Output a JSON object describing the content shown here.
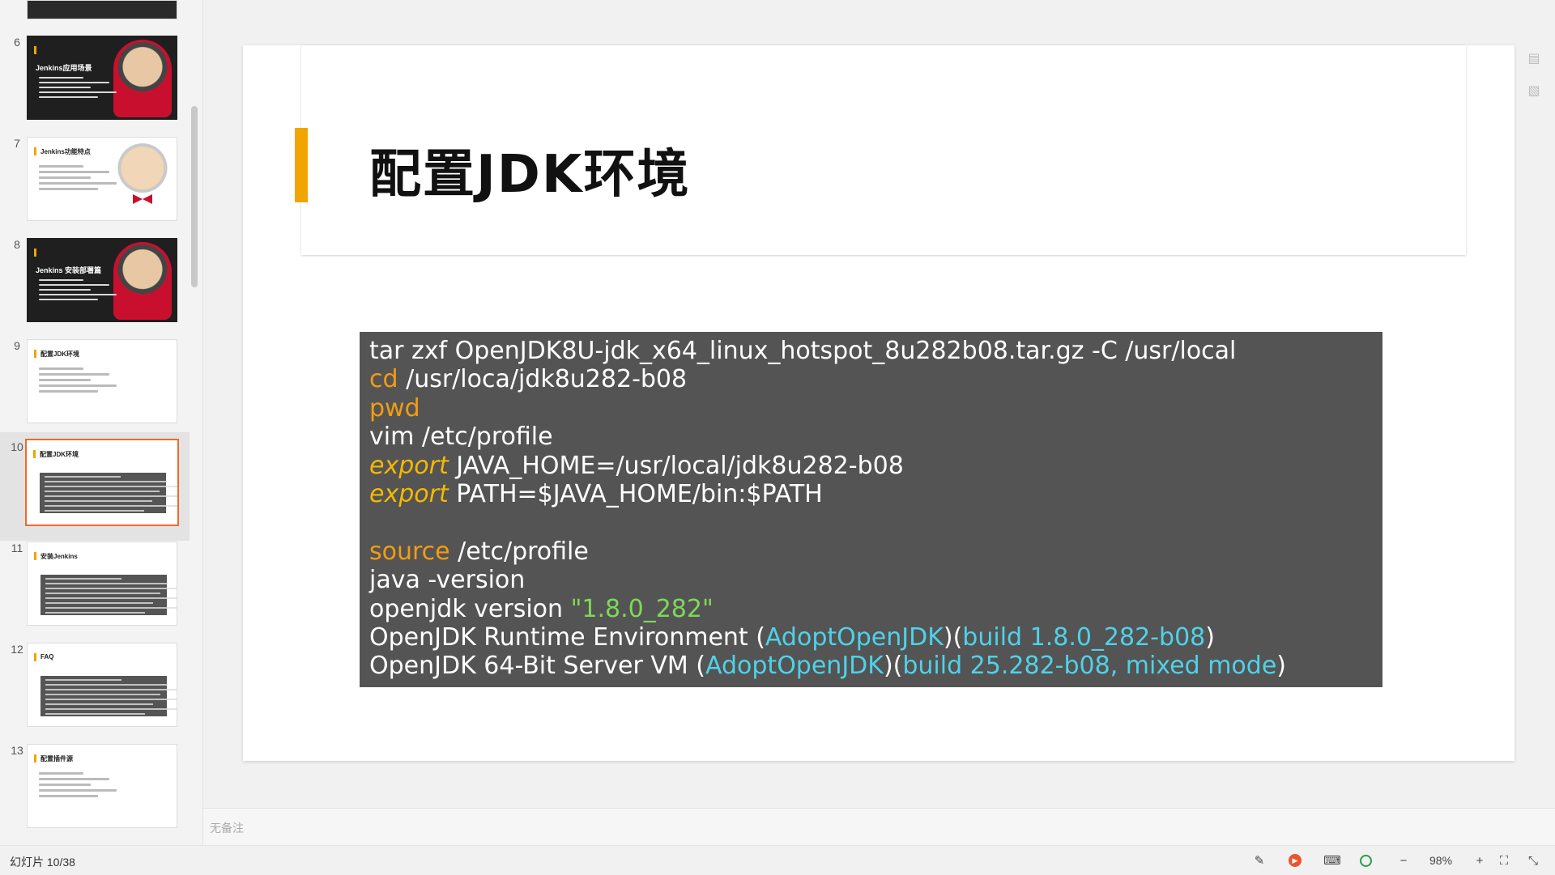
{
  "sidebar": {
    "thumbs": [
      {
        "num": "6",
        "title": "Jenkins应用场景",
        "style": "dark"
      },
      {
        "num": "7",
        "title": "Jenkins功能特点",
        "style": "mascot"
      },
      {
        "num": "8",
        "title": "Jenkins 安装部署篇",
        "style": "dark"
      },
      {
        "num": "9",
        "title": "配置JDK环境",
        "style": "text"
      },
      {
        "num": "10",
        "title": "配置JDK环境",
        "style": "code",
        "selected": true
      },
      {
        "num": "11",
        "title": "安装Jenkins",
        "style": "code"
      },
      {
        "num": "12",
        "title": "FAQ",
        "style": "code"
      },
      {
        "num": "13",
        "title": "配置插件源",
        "style": "text"
      }
    ]
  },
  "slide": {
    "title": "配置JDK环境",
    "code_lines": [
      [
        {
          "t": "tar zxf OpenJDK8U-jdk_x64_linux_hotspot_8u282b08.tar.gz -C /usr/local"
        }
      ],
      [
        {
          "t": "cd",
          "c": "kw"
        },
        {
          "t": " /usr/loca/jdk8u282-b08"
        }
      ],
      [
        {
          "t": "pwd",
          "c": "kw"
        }
      ],
      [
        {
          "t": "vim /etc/profile"
        }
      ],
      [
        {
          "t": "export",
          "c": "kw-it"
        },
        {
          "t": " JAVA_HOME=/usr/local/jdk8u282-b08"
        }
      ],
      [
        {
          "t": "export",
          "c": "kw-it"
        },
        {
          "t": " PATH=$JAVA_HOME/bin:$PATH"
        }
      ],
      [],
      [
        {
          "t": "source",
          "c": "kw"
        },
        {
          "t": " /etc/profile"
        }
      ],
      [
        {
          "t": "java -version"
        }
      ],
      [
        {
          "t": "openjdk version "
        },
        {
          "t": "\"1.8.0_282\"",
          "c": "str"
        }
      ],
      [
        {
          "t": "OpenJDK Runtime Environment ("
        },
        {
          "t": "AdoptOpenJDK",
          "c": "cyan"
        },
        {
          "t": ")("
        },
        {
          "t": "build 1.8.0_282-b08",
          "c": "cyan"
        },
        {
          "t": ")"
        }
      ],
      [
        {
          "t": "OpenJDK 64-Bit Server VM ("
        },
        {
          "t": "AdoptOpenJDK",
          "c": "cyan"
        },
        {
          "t": ")("
        },
        {
          "t": "build 25.282-b08, mixed mode",
          "c": "cyan"
        },
        {
          "t": ")"
        }
      ]
    ]
  },
  "notes": {
    "placeholder": "无备注"
  },
  "status": {
    "slide_counter": "幻灯片 10/38",
    "zoom": "98%",
    "icons": [
      "pen-icon",
      "play-icon",
      "keyboard-icon",
      "globe-icon",
      "zoom-out-icon",
      "zoom-in-icon",
      "fit-icon",
      "collapse-icon"
    ]
  },
  "colors": {
    "accent": "#f0a500",
    "selection": "#ee6a2c",
    "code_bg": "#545454"
  }
}
